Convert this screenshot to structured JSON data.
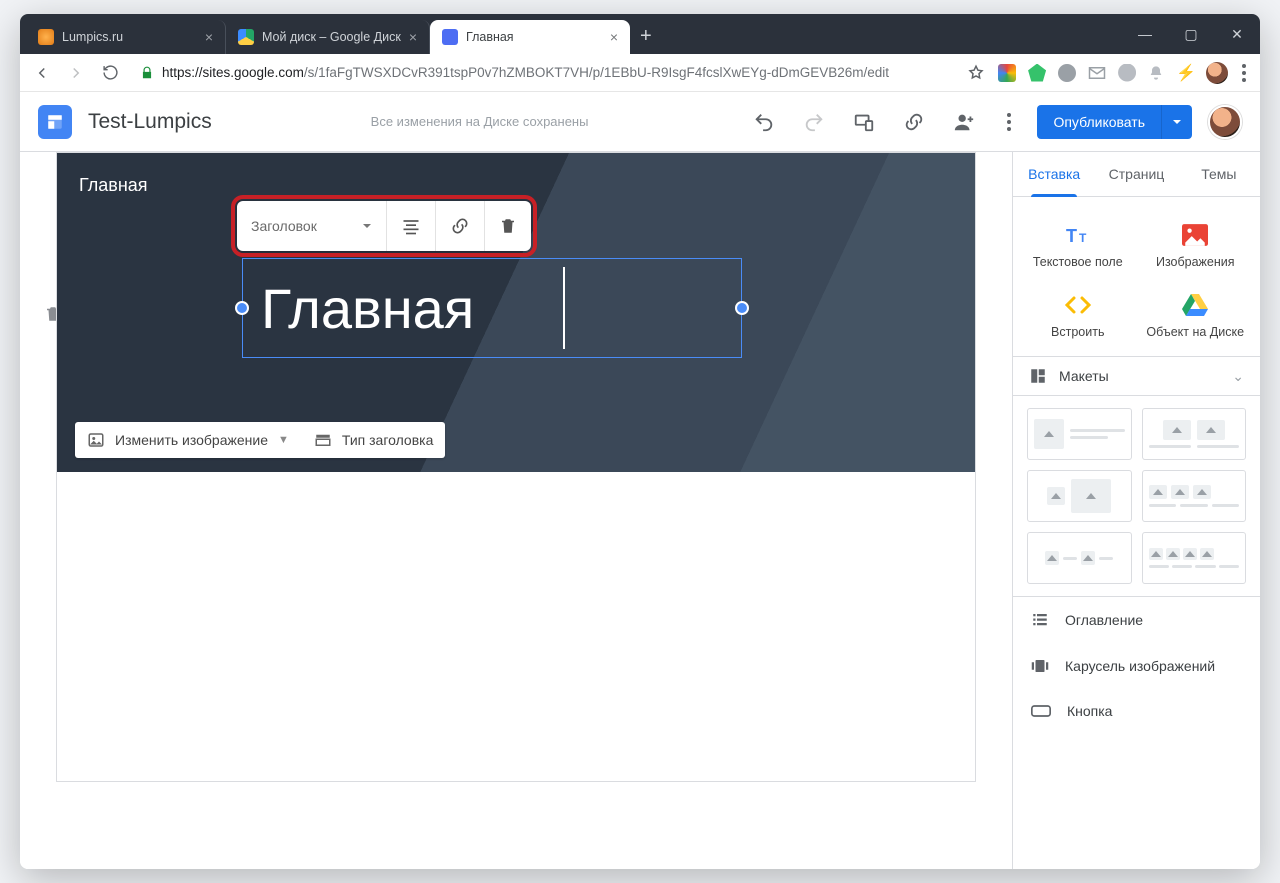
{
  "browser": {
    "tabs": [
      {
        "title": "Lumpics.ru"
      },
      {
        "title": "Мой диск – Google Диск"
      },
      {
        "title": "Главная"
      }
    ],
    "url_host": "https://sites.google.com",
    "url_path": "/s/1faFgTWSXDCvR391tspP0v7hZMBOKT7VH/p/1EBbU-R9IsgF4fcslXwEYg-dDmGEVB26m/edit"
  },
  "header": {
    "site_name": "Test-Lumpics",
    "save_status": "Все изменения на Диске сохранены",
    "publish_label": "Опубликовать"
  },
  "hero": {
    "page_name": "Главная",
    "title_text": "Главная",
    "change_image": "Изменить изображение",
    "header_type": "Тип заголовка"
  },
  "float_toolbar": {
    "style_label": "Заголовок"
  },
  "panel": {
    "tabs": {
      "insert": "Вставка",
      "pages": "Страниц",
      "themes": "Темы"
    },
    "insert": {
      "text_box": "Текстовое поле",
      "images": "Изображения",
      "embed": "Встроить",
      "drive": "Объект на Диске"
    },
    "layouts_label": "Макеты",
    "list": {
      "toc": "Оглавление",
      "carousel": "Карусель изображений",
      "button": "Кнопка"
    }
  }
}
